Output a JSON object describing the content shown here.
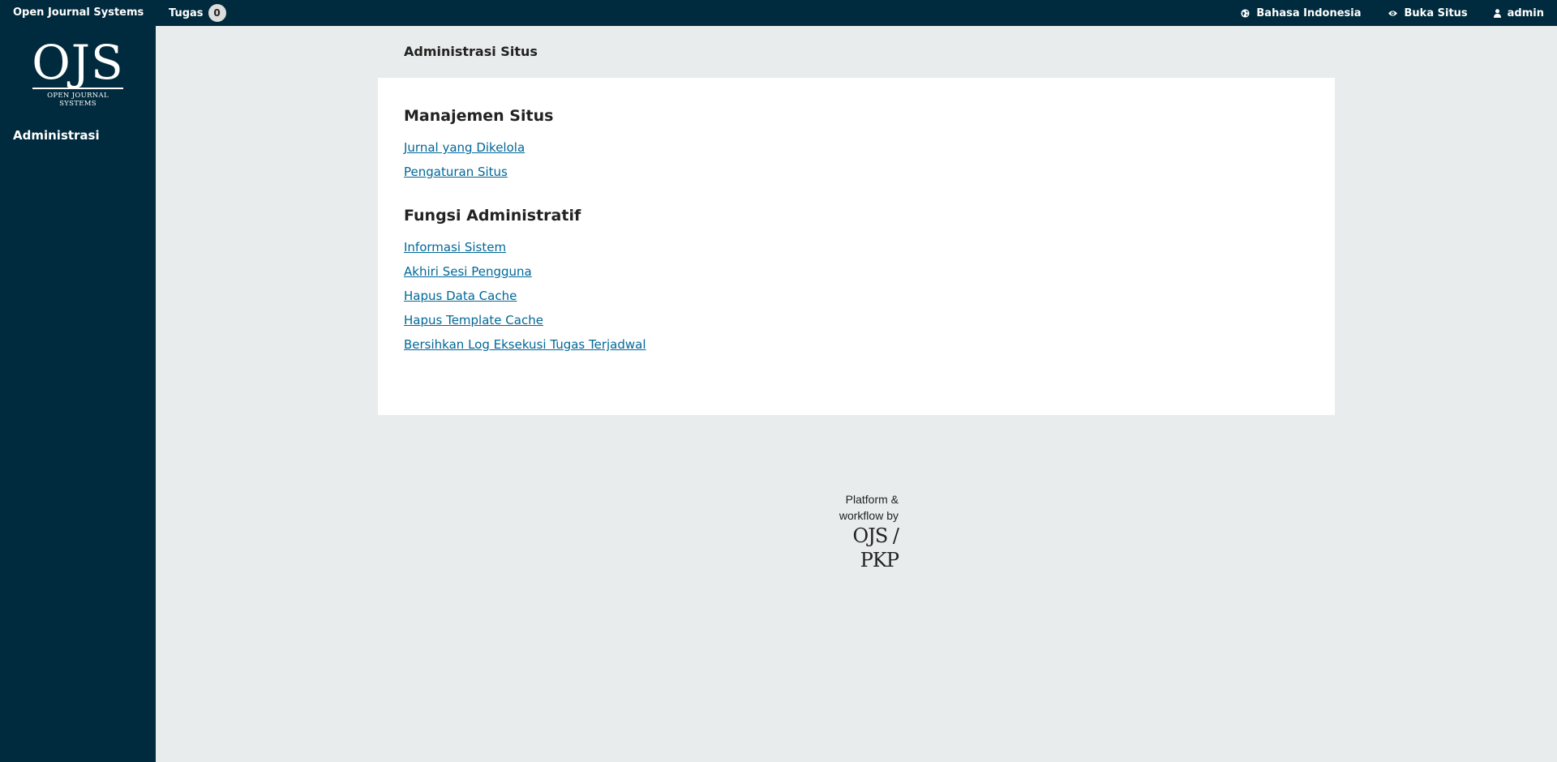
{
  "topbar": {
    "app_title": "Open Journal Systems",
    "tasks_label": "Tugas",
    "tasks_count": "0",
    "language_label": "Bahasa Indonesia",
    "view_site_label": "Buka Situs",
    "user_label": "admin"
  },
  "sidebar": {
    "logo_big": "OJS",
    "logo_small": "OPEN JOURNAL SYSTEMS",
    "items": [
      {
        "label": "Administrasi"
      }
    ]
  },
  "main": {
    "page_title": "Administrasi Situs",
    "sections": [
      {
        "heading": "Manajemen Situs",
        "links": [
          "Jurnal yang Dikelola",
          "Pengaturan Situs"
        ]
      },
      {
        "heading": "Fungsi Administratif",
        "links": [
          "Informasi Sistem",
          "Akhiri Sesi Pengguna",
          "Hapus Data Cache",
          "Hapus Template Cache",
          "Bersihkan Log Eksekusi Tugas Terjadwal"
        ]
      }
    ]
  },
  "footer": {
    "line1": "Platform &",
    "line2": "workflow by",
    "mark": "OJS / PKP"
  },
  "colors": {
    "navy": "#002a3d",
    "link": "#006798",
    "background": "#e9ecec"
  }
}
